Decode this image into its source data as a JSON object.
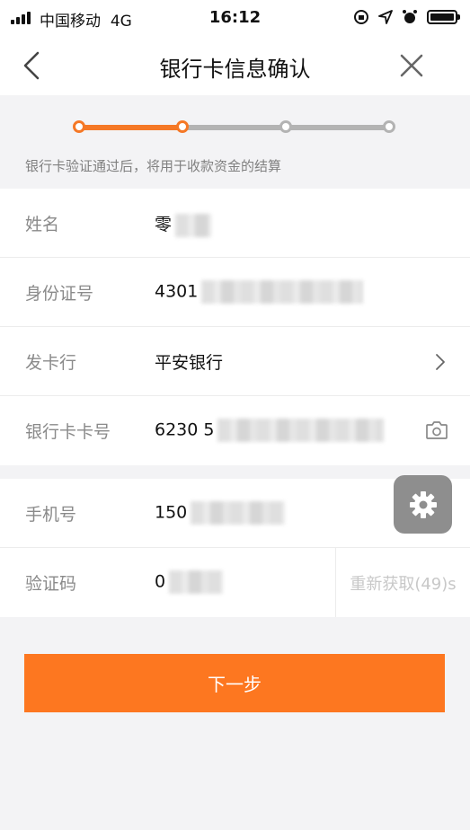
{
  "status_bar": {
    "carrier": "中国移动",
    "network": "4G",
    "time": "16:12"
  },
  "nav": {
    "title": "银行卡信息确认",
    "back_icon": "chevron-left-icon",
    "close_icon": "close-icon"
  },
  "progress": {
    "total_steps": 4,
    "current_step": 2,
    "hint": "银行卡验证通过后，将用于收款资金的结算",
    "accent_color": "#f57826",
    "inactive_color": "#b3b3b3"
  },
  "form": {
    "name": {
      "label": "姓名",
      "value": "零"
    },
    "id_number": {
      "label": "身份证号",
      "value": "4301"
    },
    "issuing_bank": {
      "label": "发卡行",
      "value": "平安银行"
    },
    "card_number": {
      "label": "银行卡卡号",
      "value": "6230 5"
    },
    "phone": {
      "label": "手机号",
      "value": "150"
    },
    "verify_code": {
      "label": "验证码",
      "value": "0",
      "resend": "重新获取(49)s"
    }
  },
  "next_button": {
    "label": "下一步",
    "color": "#fd7720"
  }
}
